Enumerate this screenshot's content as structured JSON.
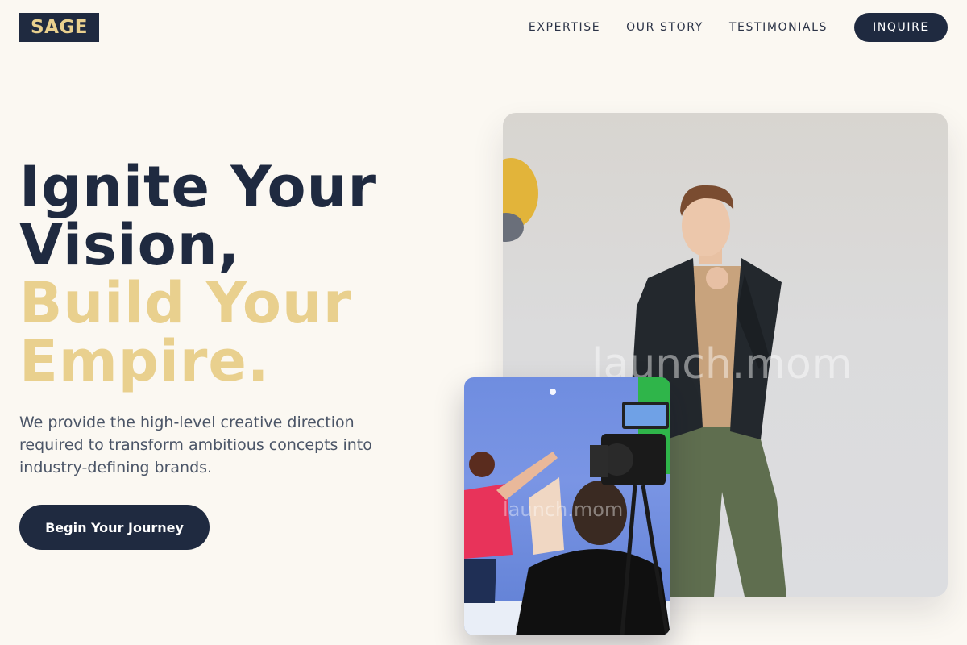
{
  "header": {
    "logo": "SAGE",
    "nav": [
      {
        "label": "EXPERTISE"
      },
      {
        "label": "OUR STORY"
      },
      {
        "label": "TESTIMONIALS"
      }
    ],
    "inquire_label": "INQUIRE"
  },
  "hero": {
    "headline_line1": "Ignite Your",
    "headline_line2": "Vision,",
    "headline_line3": "Build Your",
    "headline_line4": "Empire.",
    "subtitle": "We provide the high-level creative direction required to transform ambitious concepts into industry-defining brands.",
    "cta_label": "Begin Your Journey"
  },
  "images": {
    "main_watermark": "launch.mom",
    "small_watermark": "launch.mom"
  },
  "colors": {
    "navy": "#1f2a40",
    "gold": "#e9d08e",
    "background": "#fbf8f2"
  }
}
